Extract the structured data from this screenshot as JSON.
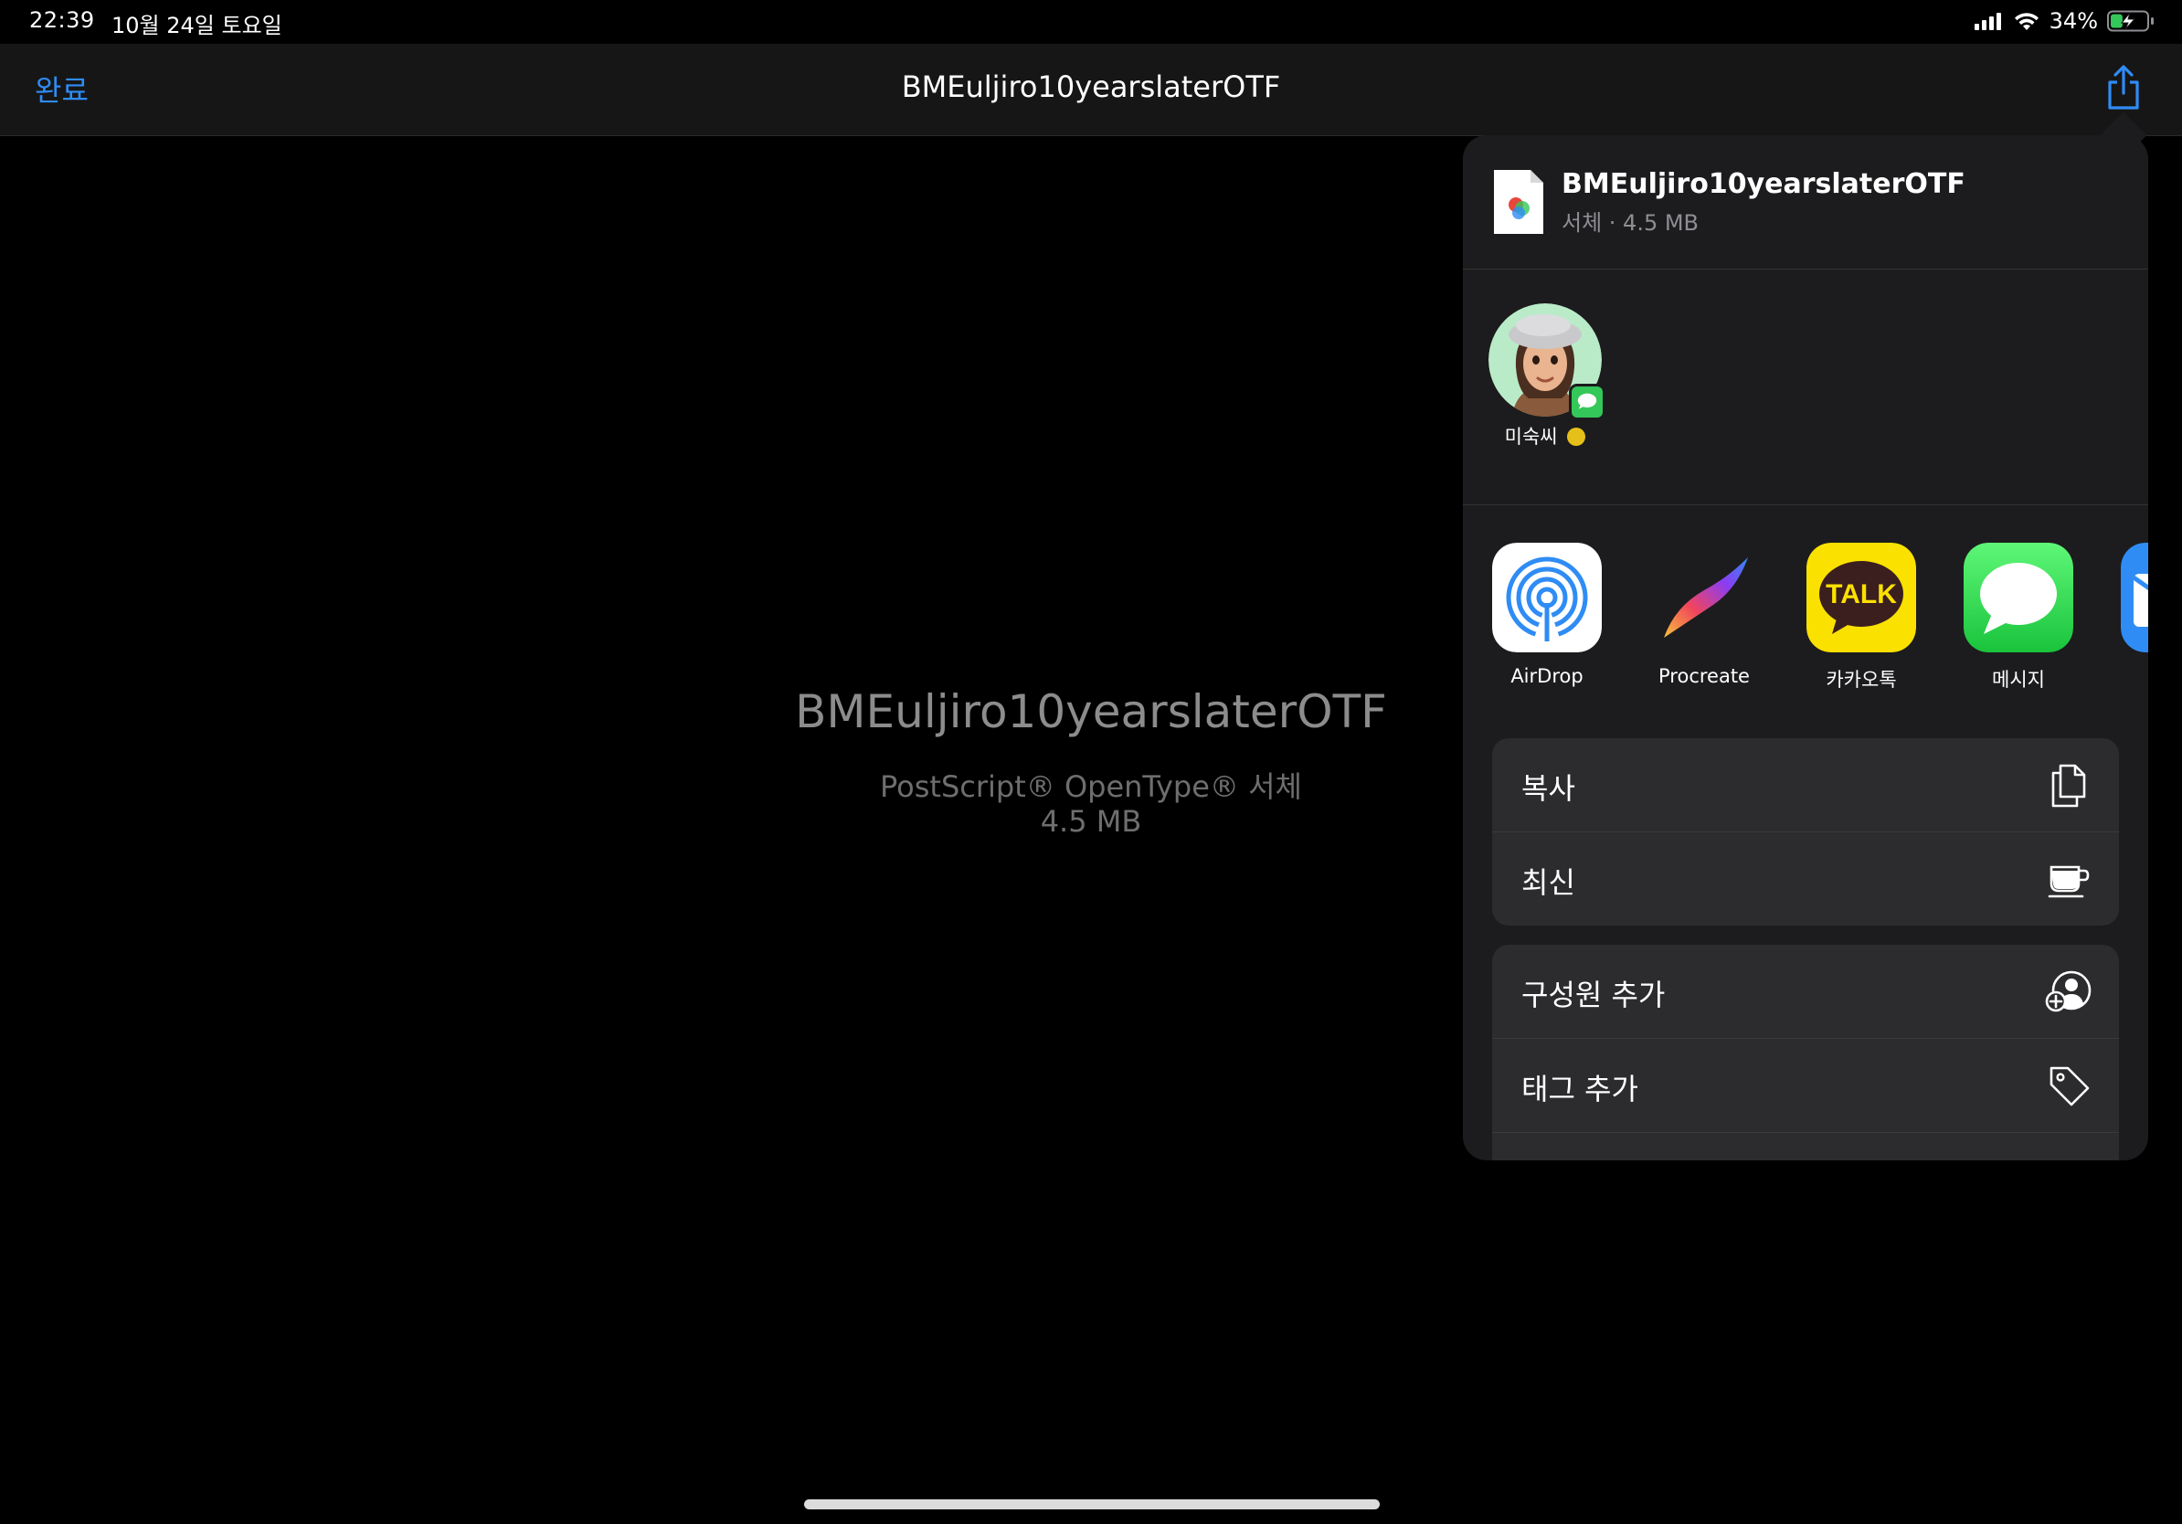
{
  "status_bar": {
    "time": "22:39",
    "date": "10월 24일 토요일",
    "battery_pct": "34%",
    "battery_level": 0.34,
    "charging": true
  },
  "nav": {
    "done_label": "완료",
    "title": "BMEuljiro10yearslaterOTF",
    "share_icon": "share-icon"
  },
  "preview": {
    "name": "BMEuljiro10yearslaterOTF",
    "kind": "PostScript® OpenType® 서체",
    "size": "4.5 MB"
  },
  "share_sheet": {
    "file": {
      "name": "BMEuljiro10yearslaterOTF",
      "meta": "서체 · 4.5 MB"
    },
    "people": [
      {
        "name": "미숙씨",
        "badge_icon": "messages-badge-icon"
      }
    ],
    "apps": [
      {
        "label": "AirDrop",
        "icon": "airdrop-icon"
      },
      {
        "label": "Procreate",
        "icon": "procreate-icon"
      },
      {
        "label": "카카오톡",
        "icon": "kakaotalk-icon",
        "icon_text": "TALK"
      },
      {
        "label": "메시지",
        "icon": "messages-icon"
      }
    ],
    "actions_group1": [
      {
        "label": "복사",
        "icon": "copy-icon"
      },
      {
        "label": "최신",
        "icon": "cup-icon"
      }
    ],
    "actions_group2": [
      {
        "label": "구성원 추가",
        "icon": "add-person-icon"
      },
      {
        "label": "태그 추가",
        "icon": "tag-icon"
      }
    ]
  },
  "colors": {
    "accent": "#2f8cf5",
    "sheet_bg": "#1c1c1e",
    "row_bg": "#2c2c2e",
    "kakao_yellow": "#fae100",
    "messages_green": "#34c759"
  }
}
